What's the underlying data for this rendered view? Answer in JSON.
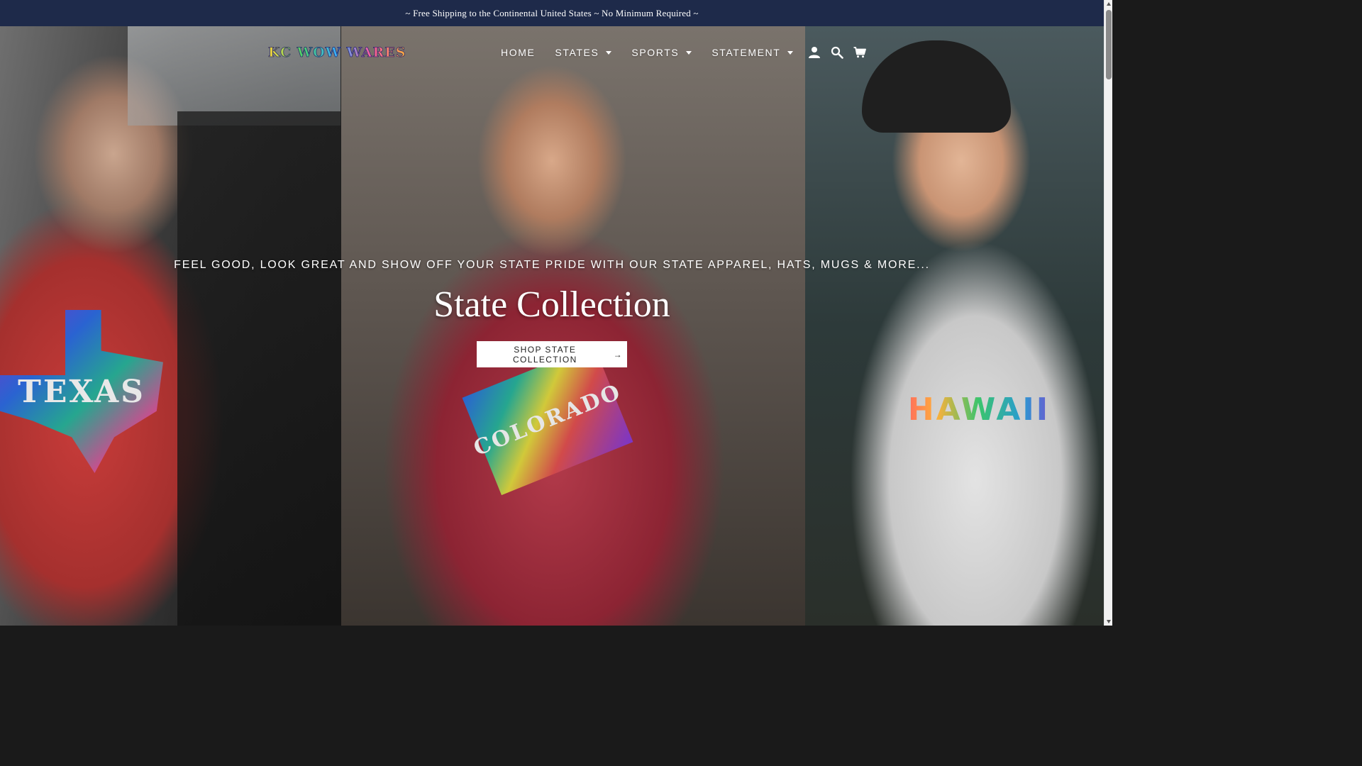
{
  "announcement": {
    "text": "~ Free Shipping to the Continental United States ~ No Minimum Required ~"
  },
  "header": {
    "logo_text": "KC WOW WARES",
    "nav": [
      {
        "label": "HOME",
        "has_dropdown": false
      },
      {
        "label": "STATES",
        "has_dropdown": true
      },
      {
        "label": "SPORTS",
        "has_dropdown": true
      },
      {
        "label": "STATEMENT",
        "has_dropdown": true
      }
    ],
    "icons": [
      "account-icon",
      "search-icon",
      "cart-icon"
    ]
  },
  "hero": {
    "subtitle": "FEEL GOOD, LOOK GREAT AND SHOW OFF YOUR STATE PRIDE WITH OUR STATE APPAREL, HATS, MUGS & MORE...",
    "title": "State Collection",
    "button_label": "SHOP STATE COLLECTION",
    "button_arrow": "→",
    "shirt_prints": {
      "left": "TEXAS",
      "middle": "COLORADO",
      "right": "HAWAII"
    },
    "slides": {
      "count": 6,
      "active": 2
    }
  },
  "colors": {
    "announcement_bg": "#1e2a4a",
    "button_bg": "#ffffff",
    "nav_text": "#ffffff"
  }
}
